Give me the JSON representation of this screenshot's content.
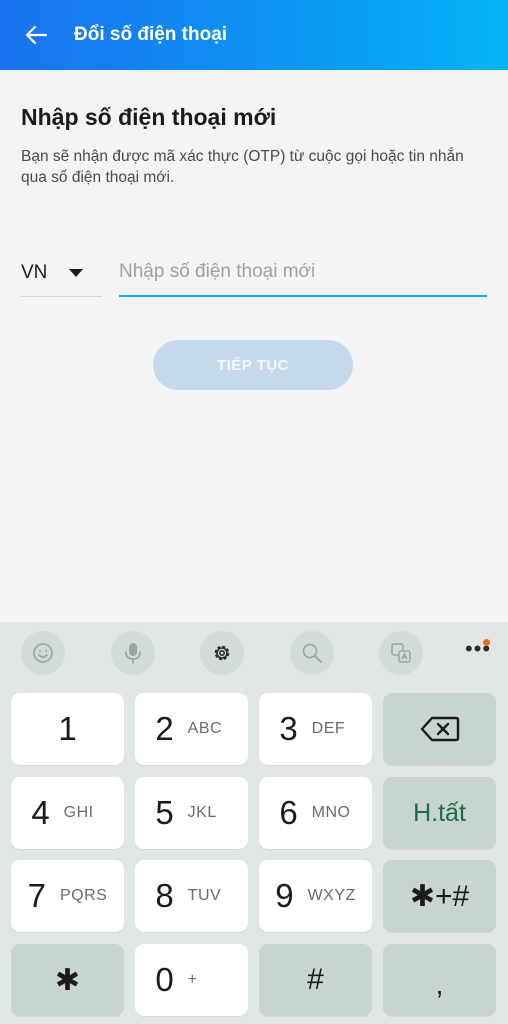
{
  "header": {
    "title": "Đổi số điện thoại",
    "back_icon": "arrow-left-icon"
  },
  "main": {
    "heading": "Nhập số điện thoại mới",
    "description": "Bạn sẽ nhận được mã xác thực (OTP) từ cuộc gọi hoặc tin nhắn qua số điện thoại mới.",
    "country_code": "VN",
    "phone_placeholder": "Nhập số điện thoại mới",
    "phone_value": "",
    "continue_label": "TIẾP TỤC"
  },
  "keyboard": {
    "toolbar": [
      "emoji-icon",
      "microphone-icon",
      "settings-icon",
      "search-icon",
      "translate-icon",
      "more-icon"
    ],
    "keys": [
      {
        "main": "1",
        "sub": ""
      },
      {
        "main": "2",
        "sub": "ABC"
      },
      {
        "main": "3",
        "sub": "DEF"
      },
      {
        "main": "4",
        "sub": "GHI"
      },
      {
        "main": "5",
        "sub": "JKL"
      },
      {
        "main": "6",
        "sub": "MNO"
      },
      {
        "main": "7",
        "sub": "PQRS"
      },
      {
        "main": "8",
        "sub": "TUV"
      },
      {
        "main": "9",
        "sub": "WXYZ"
      },
      {
        "main": "✱",
        "sub": ""
      },
      {
        "main": "0",
        "sub": "+"
      },
      {
        "main": "#",
        "sub": ""
      }
    ],
    "done_label": "H.tất",
    "symbols_label": "✱+#",
    "comma_label": ","
  },
  "colors": {
    "header_start": "#1a72f0",
    "header_end": "#05b4f7",
    "input_underline": "#19a3e8",
    "button_disabled": "#c6d9eb",
    "done_text": "#1f6b46",
    "notification_dot": "#f06a1d"
  }
}
